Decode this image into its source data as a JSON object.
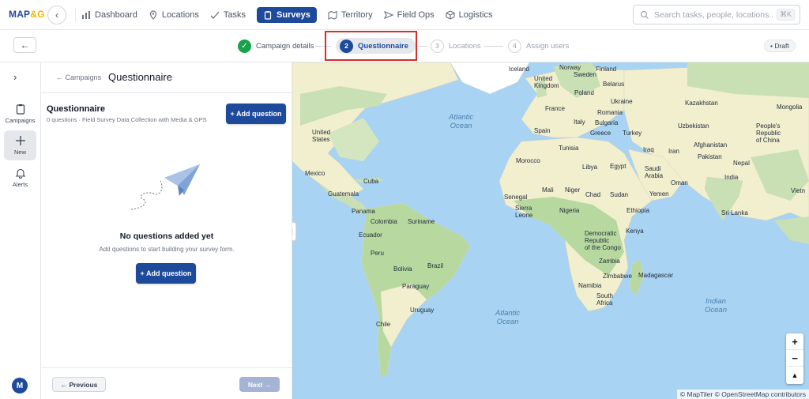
{
  "app": {
    "logo_part1": "MAP",
    "logo_part2": "&G",
    "back_icon": "chevron-left-icon"
  },
  "nav": {
    "dashboard": "Dashboard",
    "locations": "Locations",
    "tasks": "Tasks",
    "surveys": "Surveys",
    "territory": "Territory",
    "field_ops": "Field Ops",
    "logistics": "Logistics",
    "active": "Surveys"
  },
  "search": {
    "placeholder": "Search tasks, people, locations...",
    "shortcut": "⌘K"
  },
  "stepper": {
    "steps": [
      {
        "num": "✓",
        "label": "Campaign details",
        "state": "done"
      },
      {
        "num": "2",
        "label": "Questionnaire",
        "state": "current"
      },
      {
        "num": "3",
        "label": "Locations",
        "state": "todo"
      },
      {
        "num": "4",
        "label": "Assign users",
        "state": "todo"
      }
    ],
    "status_badge": "• Draft"
  },
  "rail": {
    "campaigns": "Campaigns",
    "new": "New",
    "alerts": "Alerts",
    "avatar": "M"
  },
  "panel": {
    "breadcrumb": "← Campaigns",
    "title": "Questionnaire",
    "section_title": "Questionnaire",
    "section_subtitle": "0 questions · Field Survey Data Collection with Media & GPS",
    "add_question_top": "+ Add question",
    "empty_title": "No questions added yet",
    "empty_subtitle": "Add questions to start building your survey form.",
    "add_question_center": "+ Add question",
    "previous": "← Previous",
    "next": "Next →"
  },
  "map": {
    "oceans": {
      "atlantic_north_1": "Atlantic",
      "atlantic_north_2": "Ocean",
      "atlantic_south_1": "Atlantic",
      "atlantic_south_2": "Ocean",
      "indian_1": "Indian",
      "indian_2": "Ocean"
    },
    "labels": {
      "iceland": "Iceland",
      "united_kingdom_1": "United",
      "united_kingdom_2": "Kingdom",
      "norway": "Norway",
      "sweden": "Sweden",
      "finland": "Finland",
      "belarus": "Belarus",
      "poland": "Poland",
      "ukraine": "Ukraine",
      "france": "France",
      "romania": "Romania",
      "spain": "Spain",
      "italy": "Italy",
      "bulgaria": "Bulgaria",
      "greece": "Greece",
      "turkey": "Turkey",
      "kazakhstan": "Kazakhstan",
      "mongolia": "Mongolia",
      "uzbekistan": "Uzbekistan",
      "china_1": "People's",
      "china_2": "Republic",
      "china_3": "of China",
      "united_states_1": "United",
      "united_states_2": "States",
      "tunisia": "Tunisia",
      "iraq": "Iraq",
      "iran": "Iran",
      "afghanistan": "Afghanistan",
      "pakistan": "Pakistan",
      "nepal": "Nepal",
      "morocco": "Morocco",
      "libya": "Libya",
      "egypt": "Egypt",
      "saudi_1": "Saudi",
      "saudi_2": "Arabia",
      "oman": "Oman",
      "india": "India",
      "vietnam": "Vietn",
      "mexico": "Mexico",
      "cuba": "Cuba",
      "guatemala": "Guatemala",
      "mali": "Mali",
      "niger": "Niger",
      "chad": "Chad",
      "sudan": "Sudan",
      "yemen": "Yemen",
      "senegal": "Senegal",
      "sierra_1": "Sierra",
      "sierra_2": "Leone",
      "nigeria": "Nigeria",
      "ethiopia": "Ethiopia",
      "sri_lanka": "Sri Lanka",
      "panama": "Panama",
      "colombia": "Colombia",
      "suriname": "Suriname",
      "ecuador": "Ecuador",
      "drc_1": "Democratic",
      "drc_2": "Republic",
      "drc_3": "of the Congo",
      "kenya": "Kenya",
      "peru": "Peru",
      "brazil": "Brazil",
      "zambia": "Zambia",
      "bolivia": "Bolivia",
      "zimbabwe": "Zimbabwe",
      "madagascar": "Madagascar",
      "paraguay": "Paraguay",
      "namibia": "Namibia",
      "south_africa_1": "South",
      "south_africa_2": "Africa",
      "uruguay": "Uruguay",
      "chile": "Chile"
    },
    "zoom_in": "+",
    "zoom_out": "−",
    "compass": "▲",
    "attribution": "© MapTiler © OpenStreetMap contributors"
  },
  "colors": {
    "brand": "#1e4a9c",
    "success": "#16a34a",
    "highlight": "#d32f2f",
    "water": "#a9d3f2",
    "land": "#f2efcf",
    "forest": "#b7d9a0"
  }
}
